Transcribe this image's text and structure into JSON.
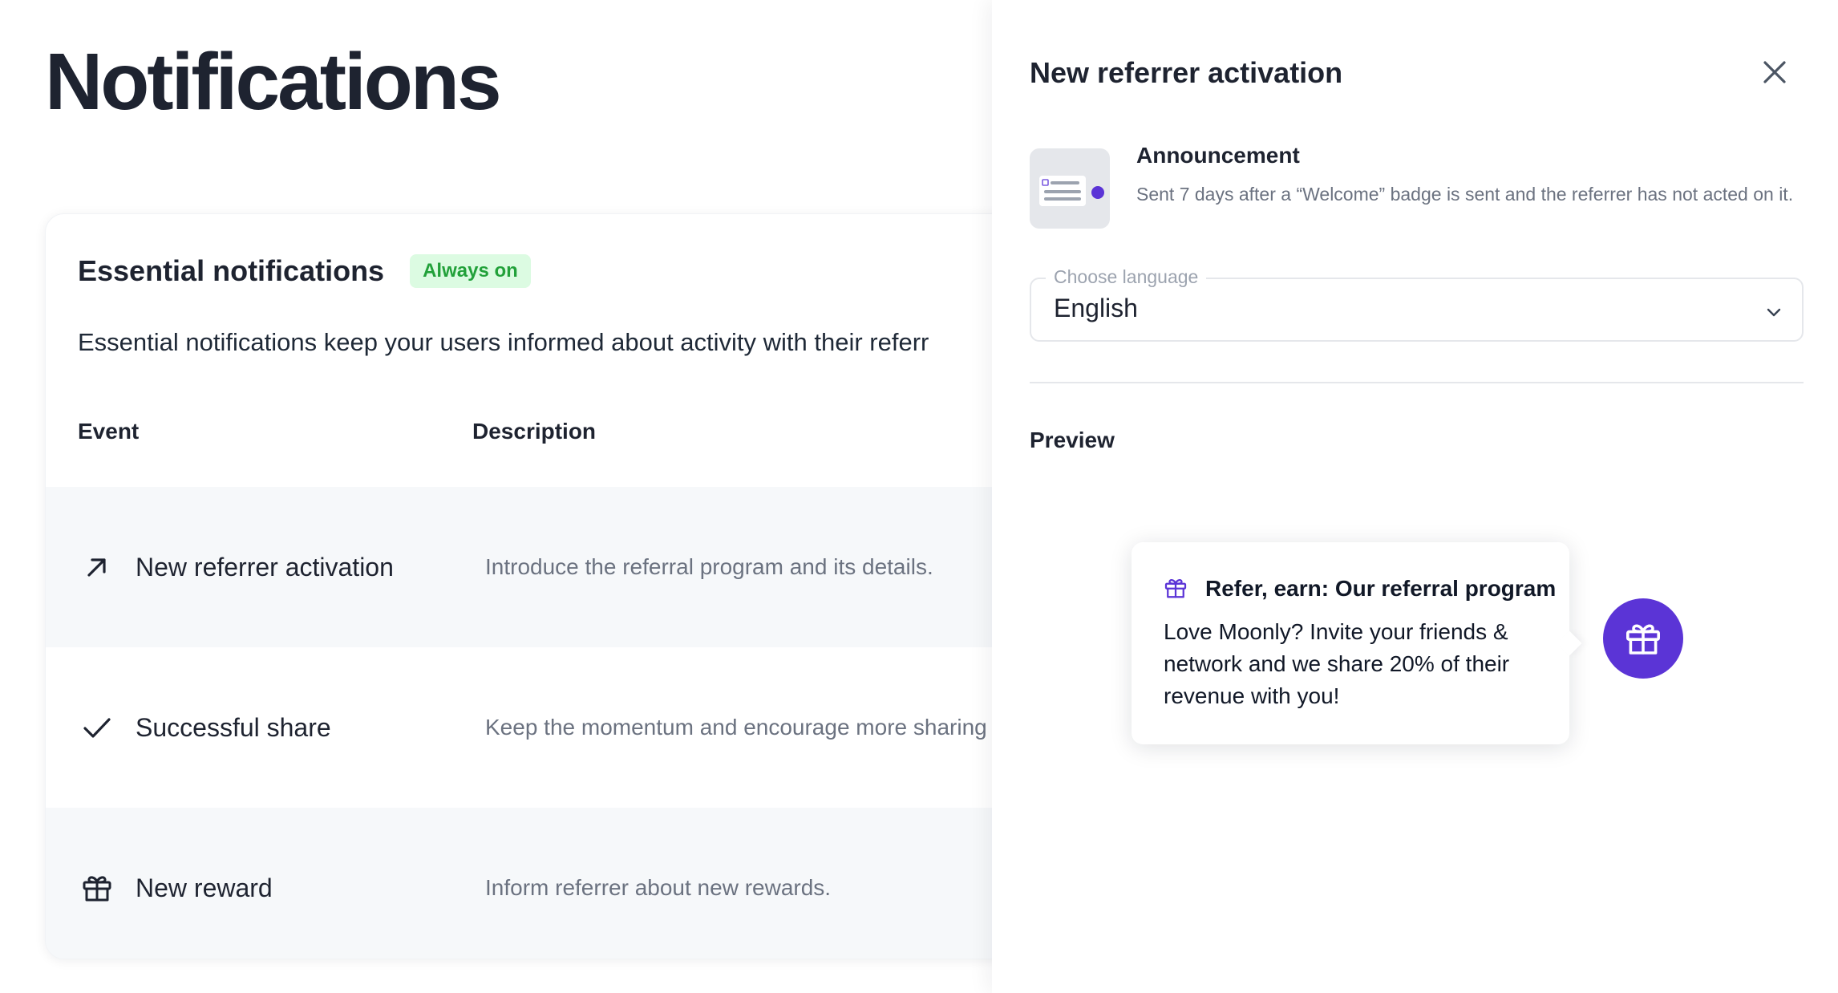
{
  "page": {
    "title": "Notifications"
  },
  "card": {
    "title": "Essential notifications",
    "badge": "Always on",
    "description": "Essential notifications keep your users informed about activity with their referr",
    "columns": {
      "event": "Event",
      "description": "Description"
    },
    "rows": [
      {
        "icon": "arrow-up-right-icon",
        "label": "New referrer activation",
        "description": "Introduce the referral program and its details."
      },
      {
        "icon": "check-icon",
        "label": "Successful share",
        "description": "Keep the momentum and encourage more sharing"
      },
      {
        "icon": "gift-icon",
        "label": "New reward",
        "description": "Inform referrer about new rewards."
      }
    ]
  },
  "drawer": {
    "title": "New referrer activation",
    "announcement": {
      "title": "Announcement",
      "description": "Sent 7 days after a “Welcome” badge is sent and the referrer has not acted on it."
    },
    "language": {
      "label": "Choose language",
      "value": "English"
    },
    "preview_label": "Preview",
    "popup": {
      "title": "Refer, earn: Our referral program",
      "body": "Love Moonly? Invite your friends & network and we share 20% of their revenue with you!"
    }
  },
  "colors": {
    "accent": "#5b34d6",
    "badge_bg": "#dcfbe2",
    "badge_text": "#22a13a",
    "row_shade": "#f6f8fa"
  }
}
